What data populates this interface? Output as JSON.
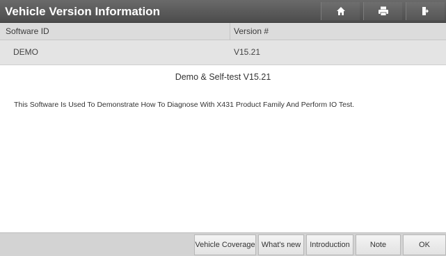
{
  "header": {
    "title": "Vehicle Version Information",
    "icons": [
      "home-icon",
      "print-icon",
      "exit-icon"
    ]
  },
  "table": {
    "columns": [
      "Software ID",
      "Version #"
    ],
    "rows": [
      {
        "software_id": "DEMO",
        "version": "V15.21"
      }
    ]
  },
  "detail": {
    "title": "Demo & Self-test V15.21",
    "description": "This Software Is Used To Demonstrate How To Diagnose With X431 Product Family And Perform IO Test."
  },
  "footer": {
    "buttons": [
      "Vehicle Coverage",
      "What's new",
      "Introduction",
      "Note",
      "OK"
    ]
  },
  "colors": {
    "titlebar": "#5a5a5a",
    "header_row": "#dcdcdc",
    "data_row": "#e4e4e4",
    "footer": "#d3d3d3"
  }
}
